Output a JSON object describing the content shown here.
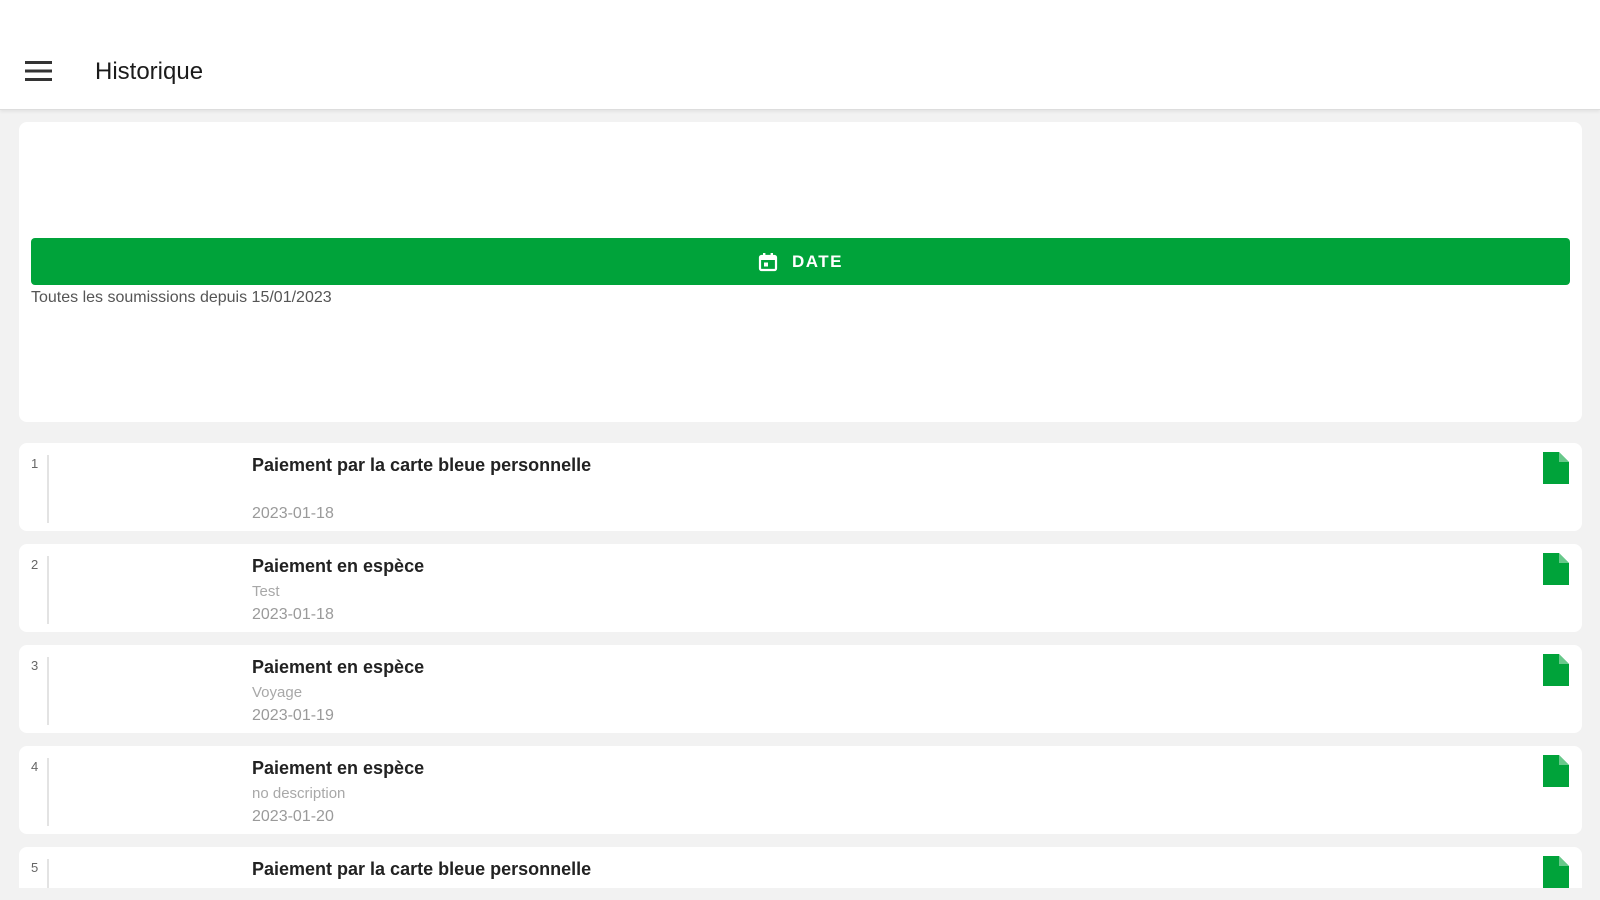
{
  "header": {
    "menu_icon": "hamburger-menu-icon",
    "title": "Historique"
  },
  "filter": {
    "date_button_label": "DATE",
    "date_button_icon": "calendar-icon",
    "caption": "Toutes les soumissions depuis 15/01/2023"
  },
  "colors": {
    "accent": "#00a33a",
    "background": "#f2f2f2"
  },
  "submissions": [
    {
      "index": "1",
      "title": "Paiement par la carte bleue personnelle",
      "description": "",
      "date": "2023-01-18",
      "icon": "document-icon"
    },
    {
      "index": "2",
      "title": "Paiement en espèce",
      "description": "Test",
      "date": "2023-01-18",
      "icon": "document-icon"
    },
    {
      "index": "3",
      "title": "Paiement en espèce",
      "description": "Voyage",
      "date": "2023-01-19",
      "icon": "document-icon"
    },
    {
      "index": "4",
      "title": "Paiement en espèce",
      "description": "no description",
      "date": "2023-01-20",
      "icon": "document-icon"
    },
    {
      "index": "5",
      "title": "Paiement par la carte bleue personnelle",
      "description": "",
      "date": "",
      "icon": "document-icon"
    }
  ]
}
